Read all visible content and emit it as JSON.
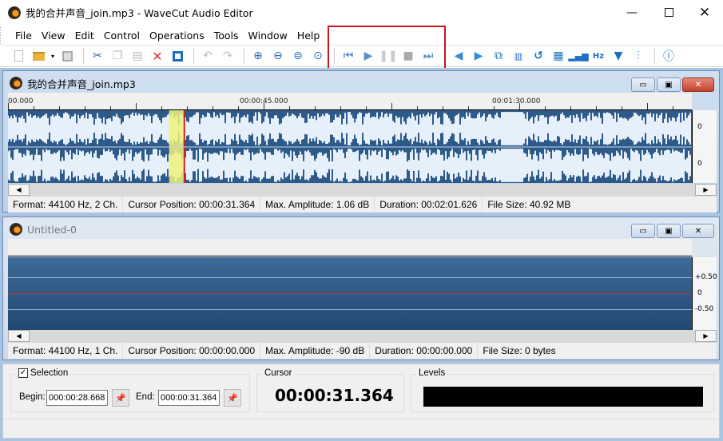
{
  "window": {
    "title": "我的合并声音_join.mp3 - WaveCut Audio Editor",
    "minimize_icon": "minimize-icon",
    "maximize_icon": "maximize-icon",
    "close_icon": "close-icon"
  },
  "menu": [
    "File",
    "View",
    "Edit",
    "Control",
    "Operations",
    "Tools",
    "Window",
    "Help"
  ],
  "toolbar": {
    "groups": [
      [
        "new-file-icon",
        "open-folder-icon",
        "dropdown-arrow-icon",
        "save-icon"
      ],
      [
        "cut-icon",
        "copy-icon",
        "paste-icon",
        "delete-icon",
        "crop-icon"
      ],
      [
        "undo-icon",
        "redo-icon"
      ],
      [
        "zoom-in-icon",
        "zoom-out-icon",
        "zoom-selection-icon",
        "zoom-fit-icon"
      ],
      [
        "go-to-start-icon",
        "play-icon",
        "pause-icon",
        "stop-icon",
        "go-to-end-icon"
      ],
      [
        "fade-in-icon",
        "fade-out-icon",
        "resize-icon",
        "normalize-icon",
        "reverse-icon",
        "amplify-icon",
        "levels-icon",
        "resample-icon",
        "filter-icon",
        "equalizer-icon"
      ],
      [
        "help-icon"
      ]
    ],
    "highlighted_group": "transport-controls"
  },
  "doc1": {
    "title": "我的合并声音_join.mp3",
    "ruler_labels": [
      "00.000",
      "00:00:45.000",
      "00:01:30.000"
    ],
    "channel_scale": [
      "0",
      "0"
    ],
    "selection": {
      "begin_sec": 28.668,
      "end_sec": 31.364,
      "duration_sec": 121.626
    },
    "status": {
      "format": "Format: 44100 Hz, 2 Ch.",
      "cursor": "Cursor Position: 00:00:31.364",
      "amplitude": "Max. Amplitude: 1.06 dB",
      "duration": "Duration: 00:02:01.626",
      "filesize": "File Size: 40.92 MB"
    }
  },
  "doc2": {
    "title": "Untitled-0",
    "scale": [
      "+0.50",
      "0",
      "-0.50"
    ],
    "status": {
      "format": "Format: 44100 Hz, 1 Ch.",
      "cursor": "Cursor Position: 00:00:00.000",
      "amplitude": "Max. Amplitude: -90 dB",
      "duration": "Duration: 00:00:00.000",
      "filesize": "File Size: 0 bytes"
    }
  },
  "bottom": {
    "selection_label": "Selection",
    "selection_checked": true,
    "begin_label": "Begin:",
    "begin_value": "000:00:28.668",
    "end_label": "End:",
    "end_value": "000:00:31.364",
    "cursor_label": "Cursor",
    "cursor_value": "00:00:31.364",
    "levels_label": "Levels"
  },
  "colors": {
    "highlight": "#c8161e",
    "wave_bg": "#2e5a8a",
    "wave_fg": "#e6f0fa",
    "selection": "#eef27a"
  }
}
